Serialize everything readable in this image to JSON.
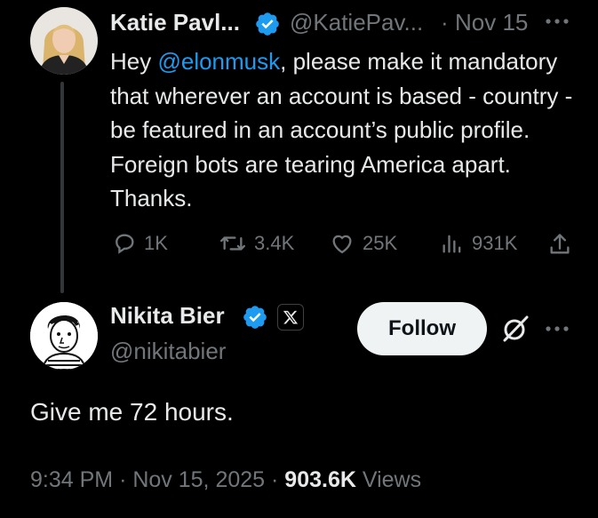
{
  "parent_tweet": {
    "author_name": "Katie Pavl...",
    "handle": "@KatiePav...",
    "separator": "·",
    "date": "Nov 15",
    "text_before": "Hey ",
    "mention": "@elonmusk",
    "text_after": ", please make it mandatory that wherever an account is based - country - be featured in an account’s public profile. Foreign bots are tearing America apart. Thanks.",
    "actions": {
      "replies": "1K",
      "reposts": "3.4K",
      "likes": "25K",
      "views": "931K"
    }
  },
  "main_tweet": {
    "author_name": "Nikita Bier",
    "handle": "@nikitabier",
    "follow_label": "Follow",
    "text": "Give me 72 hours.",
    "time": "9:34 PM",
    "sep1": "·",
    "date": "Nov 15, 2025",
    "sep2": "·",
    "views_count": "903.6K",
    "views_label": "Views"
  },
  "icons": {
    "verified": "verified-badge-icon",
    "affiliate": "x-logo-icon",
    "more": "more-icon",
    "reply": "reply-icon",
    "repost": "repost-icon",
    "like": "heart-icon",
    "views": "views-icon",
    "share": "share-icon",
    "grok": "grok-icon"
  },
  "colors": {
    "background": "#000000",
    "text": "#e7e9ea",
    "muted": "#71767b",
    "accent": "#1d9bf0",
    "follow_bg": "#eff3f4"
  }
}
